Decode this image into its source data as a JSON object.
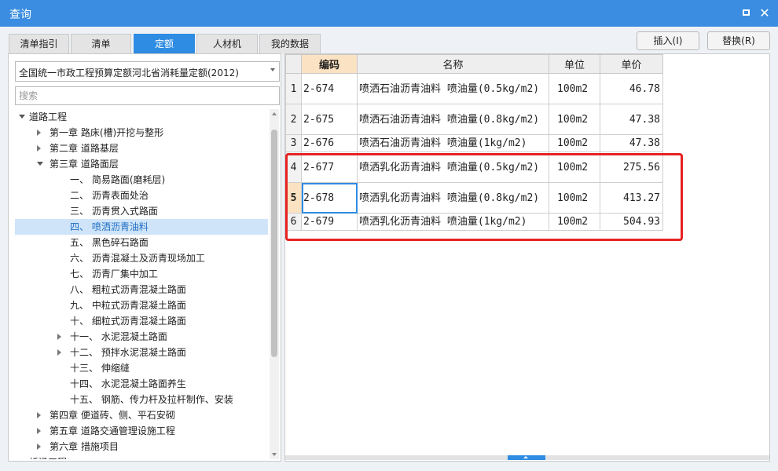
{
  "window": {
    "title": "查询"
  },
  "tabs": [
    {
      "label": "清单指引"
    },
    {
      "label": "清单"
    },
    {
      "label": "定额"
    },
    {
      "label": "人材机"
    },
    {
      "label": "我的数据"
    }
  ],
  "buttons": {
    "insert": "插入(I)",
    "replace": "替换(R)"
  },
  "left": {
    "combo_value": "全国统一市政工程预算定额河北省消耗量定额(2012)",
    "search_placeholder": "搜索",
    "tree": [
      {
        "label": "道路工程",
        "toggle": "expanded"
      },
      {
        "label": "第一章 路床(槽)开挖与整形",
        "toggle": "collapsed"
      },
      {
        "label": "第二章 道路基层",
        "toggle": "collapsed"
      },
      {
        "label": "第三章 道路面层",
        "toggle": "expanded"
      },
      {
        "label": "一、  简易路面(磨耗层)",
        "toggle": "none"
      },
      {
        "label": "二、  沥青表面处治",
        "toggle": "none"
      },
      {
        "label": "三、  沥青贯入式路面",
        "toggle": "none"
      },
      {
        "label": "四、  喷洒沥青油料",
        "toggle": "none",
        "selected": true
      },
      {
        "label": "五、  黑色碎石路面",
        "toggle": "none"
      },
      {
        "label": "六、  沥青混凝土及沥青现场加工",
        "toggle": "none"
      },
      {
        "label": "七、  沥青厂集中加工",
        "toggle": "none"
      },
      {
        "label": "八、  粗粒式沥青混凝土路面",
        "toggle": "none"
      },
      {
        "label": "九、  中粒式沥青混凝土路面",
        "toggle": "none"
      },
      {
        "label": "十、  细粒式沥青混凝土路面",
        "toggle": "none"
      },
      {
        "label": "十一、  水泥混凝土路面",
        "toggle": "collapsed"
      },
      {
        "label": "十二、  预拌水泥混凝土路面",
        "toggle": "collapsed"
      },
      {
        "label": "十三、  伸缩缝",
        "toggle": "none"
      },
      {
        "label": "十四、  水泥混凝土路面养生",
        "toggle": "none"
      },
      {
        "label": "十五、  钢筋、传力杆及拉杆制作、安装",
        "toggle": "none"
      },
      {
        "label": "第四章 便道砖、侧、平石安砌",
        "toggle": "collapsed"
      },
      {
        "label": "第五章 道路交通管理设施工程",
        "toggle": "collapsed"
      },
      {
        "label": "第六章 措施项目",
        "toggle": "collapsed"
      },
      {
        "label": "桥涵工程",
        "toggle": "expanded"
      }
    ]
  },
  "grid": {
    "headers": {
      "code": "编码",
      "name": "名称",
      "unit": "单位",
      "price": "单价"
    },
    "rows": [
      {
        "n": "1",
        "code": "2-674",
        "name": "喷洒石油沥青油料 喷油量(0.5kg/m2)",
        "unit": "100m2",
        "price": "46.78"
      },
      {
        "n": "2",
        "code": "2-675",
        "name": "喷洒石油沥青油料 喷油量(0.8kg/m2)",
        "unit": "100m2",
        "price": "47.38"
      },
      {
        "n": "3",
        "code": "2-676",
        "name": "喷洒石油沥青油料 喷油量(1kg/m2)",
        "unit": "100m2",
        "price": "47.38"
      },
      {
        "n": "4",
        "code": "2-677",
        "name": "喷洒乳化沥青油料 喷油量(0.5kg/m2)",
        "unit": "100m2",
        "price": "275.56"
      },
      {
        "n": "5",
        "code": "2-678",
        "name": "喷洒乳化沥青油料 喷油量(0.8kg/m2)",
        "unit": "100m2",
        "price": "413.27"
      },
      {
        "n": "6",
        "code": "2-679",
        "name": "喷洒乳化沥青油料 喷油量(1kg/m2)",
        "unit": "100m2",
        "price": "504.93"
      }
    ]
  },
  "colors": {
    "accent": "#2e8ce3",
    "titlebar": "#3a8de0",
    "highlight_box": "#e62222",
    "header_highlight": "#fbe2c2"
  }
}
